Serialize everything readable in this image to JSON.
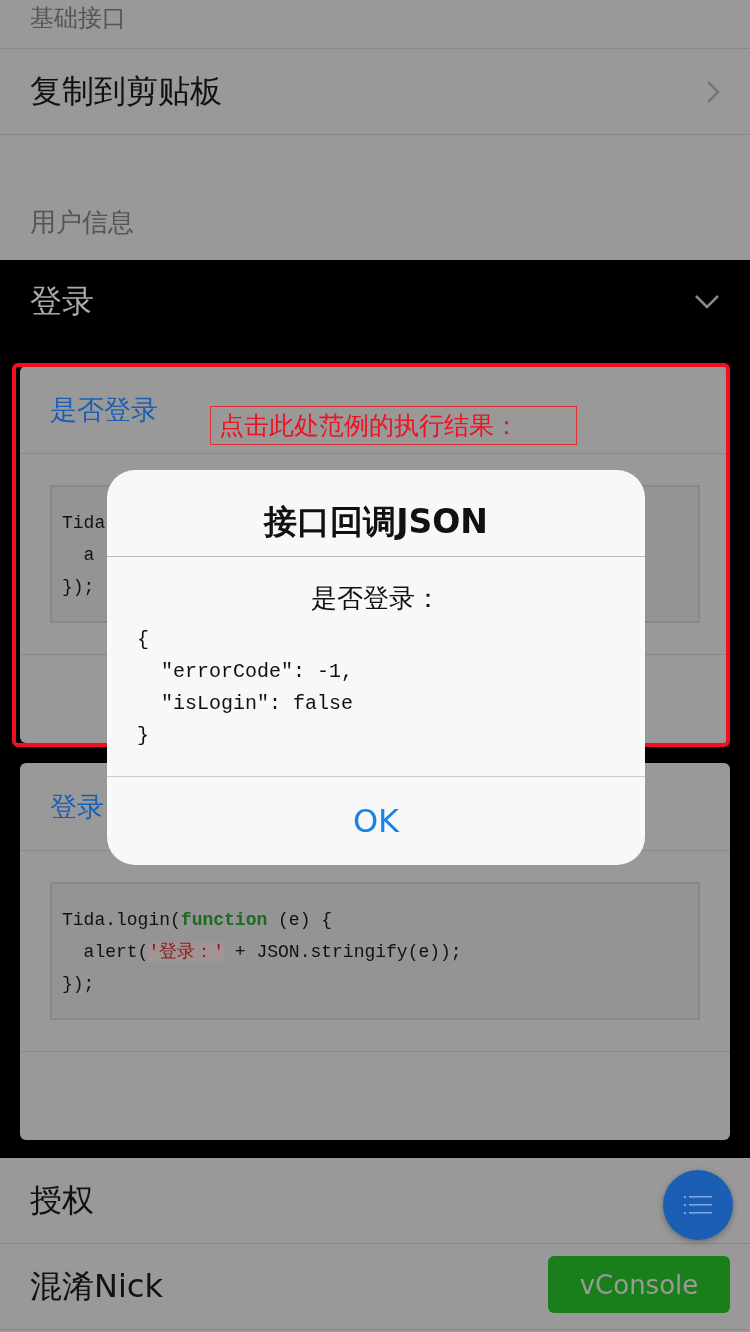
{
  "sections_top": [
    {
      "header": "基础接口",
      "rows": [
        {
          "label": "复制到剪贴板",
          "has_chevron": true
        }
      ]
    },
    {
      "header": "用户信息"
    }
  ],
  "expanded": {
    "title": "登录",
    "expanded": true,
    "cards": [
      {
        "title": "是否登录",
        "code": [
          [
            {
              "kind": "plain",
              "text": "Tida"
            }
          ],
          [
            {
              "kind": "plain",
              "text": "  a"
            }
          ],
          [
            {
              "kind": "plain",
              "text": "});"
            }
          ]
        ]
      },
      {
        "title": "登录",
        "code": [
          [
            {
              "kind": "plain",
              "text": "Tida.login("
            },
            {
              "kind": "keyword",
              "text": "function"
            },
            {
              "kind": "plain",
              "text": " (e) {"
            }
          ],
          [
            {
              "kind": "plain",
              "text": "  alert("
            },
            {
              "kind": "string",
              "text": "'登录：'"
            },
            {
              "kind": "plain",
              "text": " + JSON.stringify(e));"
            }
          ],
          [
            {
              "kind": "plain",
              "text": "});"
            }
          ]
        ]
      }
    ]
  },
  "rows_bottom": [
    {
      "label": "授权"
    },
    {
      "label": "混淆Nick"
    }
  ],
  "annotation": {
    "label": "点击此处范例的执行结果："
  },
  "dialog": {
    "title": "接口回调JSON",
    "heading": "是否登录：",
    "lines": [
      "{",
      "  \"errorCode\": -1,",
      "  \"isLogin\": false",
      "}"
    ],
    "button": "OK"
  },
  "vconsole": {
    "button": "vConsole"
  }
}
